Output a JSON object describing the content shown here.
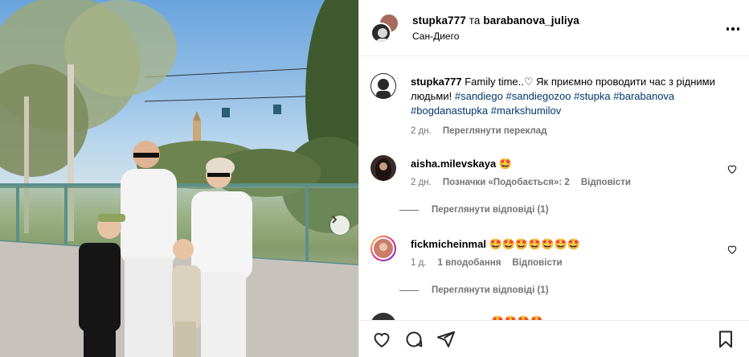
{
  "header": {
    "user1": "stupka777",
    "conjunction": "та",
    "user2": "barabanova_juliya",
    "location": "Сан-Диего"
  },
  "caption": {
    "username": "stupka777",
    "text": "Family time..♡ Як приємно проводити час з рідними людьми!",
    "hashtags": [
      "#sandiego",
      "#sandiegozoo",
      "#stupka",
      "#barabanova",
      "#bogdanastupka",
      "#markshumilov"
    ],
    "time": "2 дн.",
    "translate": "Переглянути переклад"
  },
  "comments": [
    {
      "username": "aisha.milevskaya",
      "text": "🤩",
      "time": "2 дн.",
      "likes": "Позначки «Подобається»: 2",
      "reply": "Відповісти",
      "view_replies": "Переглянути відповіді (1)"
    },
    {
      "username": "fickmicheinmal",
      "text": "🤩🤩🤩🤩🤩🤩🤩",
      "time": "1 д.",
      "likes": "1 вподобання",
      "reply": "Відповісти",
      "view_replies": "Переглянути відповіді (1)"
    },
    {
      "username": "",
      "text": "🤩🤩🤩🤩"
    }
  ],
  "icons": {
    "like": "heart-icon",
    "comment": "comment-icon",
    "share": "share-icon",
    "save": "bookmark-icon",
    "more": "more-icon",
    "next": "chevron-right-icon"
  },
  "colors": {
    "link": "#00376b",
    "muted": "#737373",
    "divider": "#efefef"
  }
}
